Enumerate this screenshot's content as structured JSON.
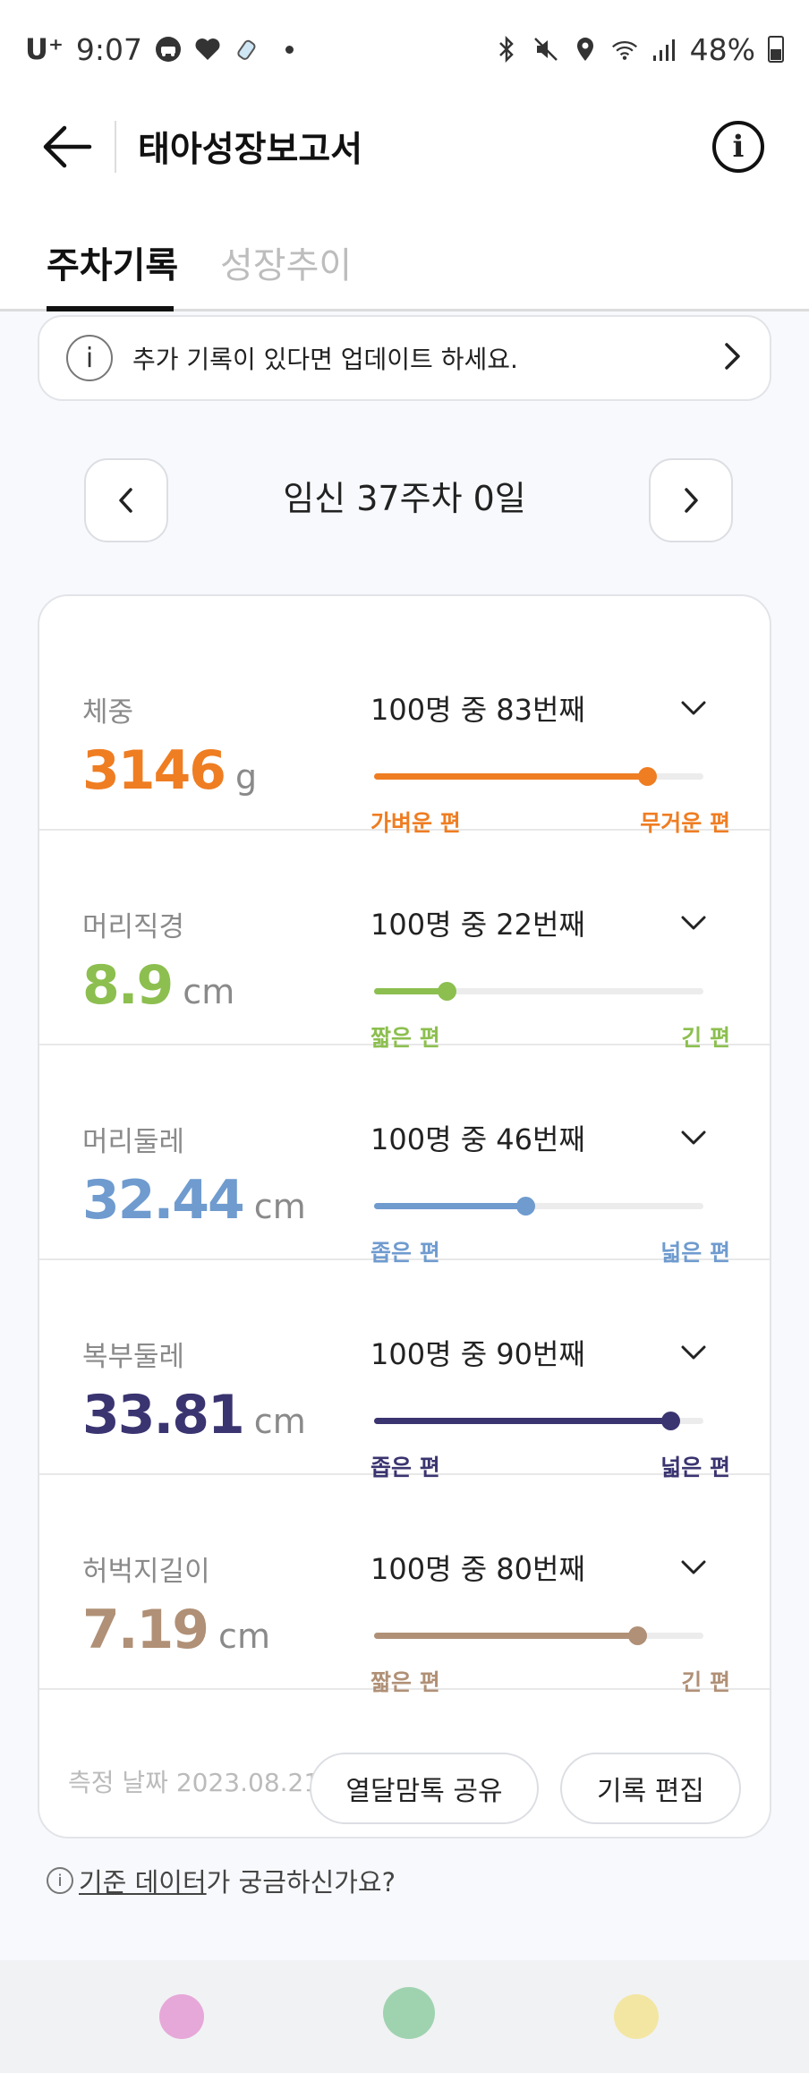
{
  "status_bar": {
    "carrier": "U⁺",
    "time": "9:07",
    "battery": "48%"
  },
  "header": {
    "title": "태아성장보고서",
    "info_label": "i"
  },
  "tabs": [
    {
      "label": "주차기록",
      "active": true
    },
    {
      "label": "성장추이",
      "active": false
    }
  ],
  "notice": {
    "icon_label": "i",
    "text": "추가 기록이 있다면 업데이트 하세요."
  },
  "week_nav": {
    "label": "임신 37주차 0일"
  },
  "metrics": [
    {
      "name": "체중",
      "value": "3146",
      "unit": "g",
      "rank": "100명 중 83번째",
      "rank_value": 83,
      "left_label": "가벼운 편",
      "right_label": "무거운 편",
      "color": "#ef7d22"
    },
    {
      "name": "머리직경",
      "value": "8.9",
      "unit": "cm",
      "rank": "100명 중 22번째",
      "rank_value": 22,
      "left_label": "짧은 편",
      "right_label": "긴 편",
      "color": "#8cbf4f"
    },
    {
      "name": "머리둘레",
      "value": "32.44",
      "unit": "cm",
      "rank": "100명 중 46번째",
      "rank_value": 46,
      "left_label": "좁은 편",
      "right_label": "넓은 편",
      "color": "#6f9bcf"
    },
    {
      "name": "복부둘레",
      "value": "33.81",
      "unit": "cm",
      "rank": "100명 중 90번째",
      "rank_value": 90,
      "left_label": "좁은 편",
      "right_label": "넓은 편",
      "color": "#3a3470"
    },
    {
      "name": "허벅지길이",
      "value": "7.19",
      "unit": "cm",
      "rank": "100명 중 80번째",
      "rank_value": 80,
      "left_label": "짧은 편",
      "right_label": "긴 편",
      "color": "#b09076"
    }
  ],
  "footer": {
    "date": "측정 날짜 2023.08.21",
    "share_label": "열달맘톡 공유",
    "edit_label": "기록 편집"
  },
  "footnote": {
    "icon_label": "i",
    "link_text": "기준 데이터",
    "rest_text": "가 궁금하신가요?"
  },
  "bottom_nav": {
    "colors": [
      "#e6a8d8",
      "#9fd3b0",
      "#f3e6a3"
    ]
  }
}
